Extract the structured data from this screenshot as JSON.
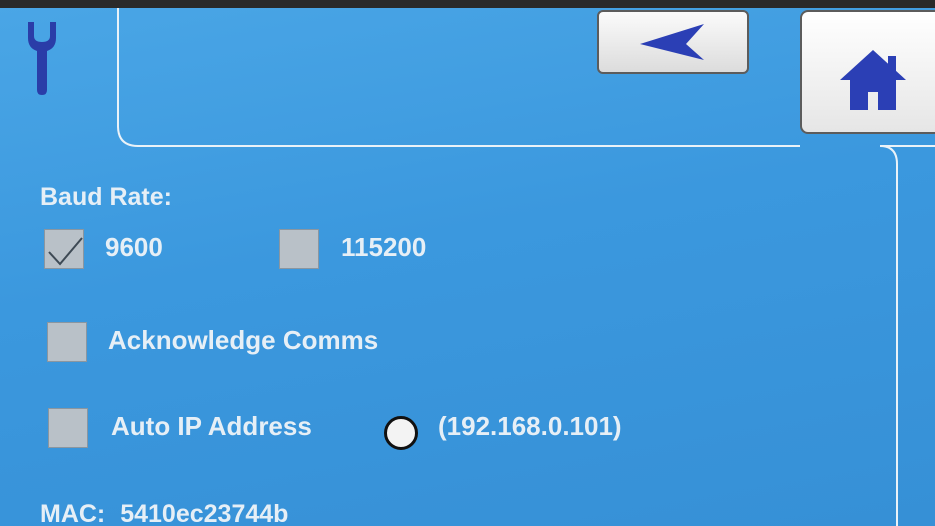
{
  "toolbar": {
    "back_icon": "back-arrow-icon",
    "home_icon": "home-icon",
    "tab_icon": "wrench-icon"
  },
  "baud": {
    "heading": "Baud Rate:",
    "option_9600": "9600",
    "option_9600_checked": true,
    "option_115200": "115200",
    "option_115200_checked": false
  },
  "comms": {
    "acknowledge_label": "Acknowledge Comms",
    "acknowledge_checked": false
  },
  "network": {
    "auto_ip_label": "Auto IP Address",
    "auto_ip_checked": false,
    "ip_value": "(192.168.0.101)",
    "mac_label": "MAC:",
    "mac_value": "5410ec23744b"
  },
  "colors": {
    "background": "#3b98de",
    "text": "#e6eff6",
    "accent_icon": "#2b3fb5"
  }
}
